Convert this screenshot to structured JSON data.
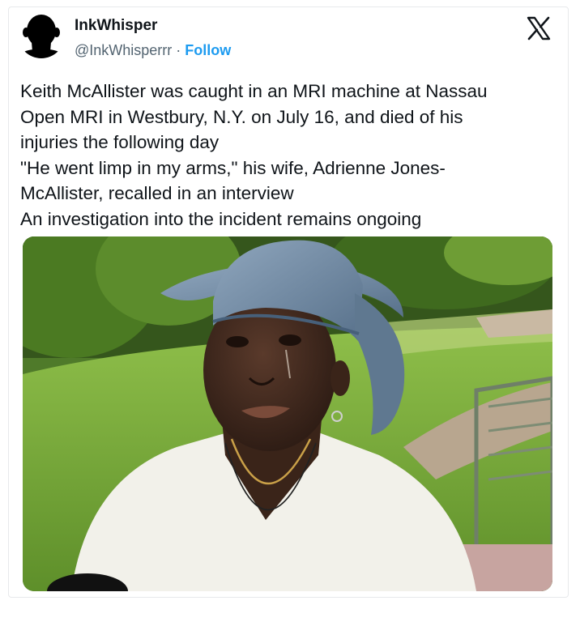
{
  "user": {
    "display_name": "InkWhisper",
    "handle": "@InkWhisperrr",
    "separator": " · ",
    "follow_label": "Follow",
    "avatar_icon": "silhouette-avatar-icon"
  },
  "platform": {
    "logo_icon": "x-logo-icon"
  },
  "tweet": {
    "lines": [
      "Keith McAllister was caught in an MRI machine at Nassau",
      "Open MRI in Westbury, N.Y. on July 16, and died of his",
      "injuries the following day",
      "\"He went limp in my arms,\" his wife, Adrienne Jones-",
      "McAllister, recalled in an interview",
      "An investigation into the incident remains ongoing"
    ]
  },
  "colors": {
    "text": "#0f1419",
    "secondary_text": "#536471",
    "follow_blue": "#1d9bf0"
  }
}
